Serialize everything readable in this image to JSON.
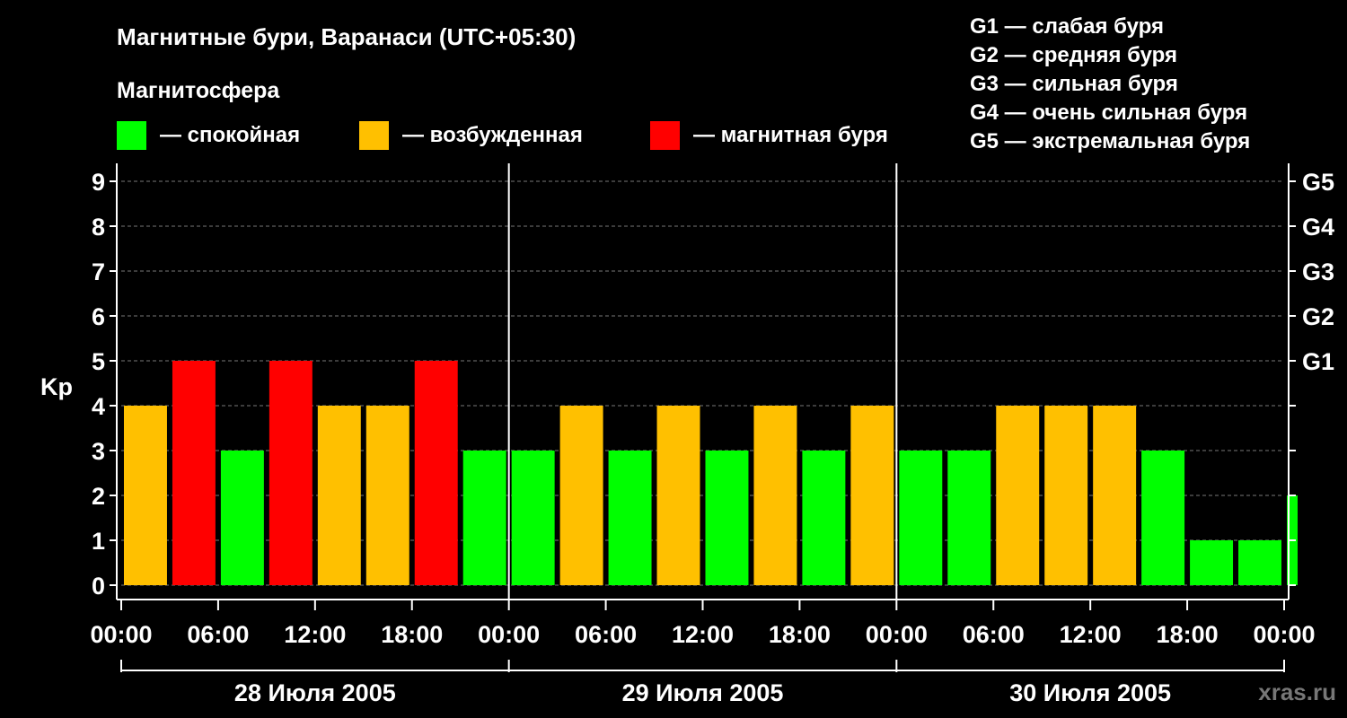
{
  "header": {
    "title": "Магнитные бури, Варанаси (UTC+05:30)",
    "magnetosphere_label": "Магнитосфера"
  },
  "legend": {
    "items": [
      {
        "label": "— спокойная",
        "color": "#00ff00"
      },
      {
        "label": "— возбужденная",
        "color": "#ffc000"
      },
      {
        "label": "— магнитная буря",
        "color": "#ff0000"
      }
    ]
  },
  "g_scale_legend": [
    "G1 — слабая буря",
    "G2 — средняя буря",
    "G3 — сильная буря",
    "G4 — очень сильная буря",
    "G5 — экстремальная буря"
  ],
  "watermark": "xras.ru",
  "chart_data": {
    "type": "bar",
    "ylabel": "Kp",
    "ylim": [
      0,
      9
    ],
    "yticks": [
      "0",
      "1",
      "2",
      "3",
      "4",
      "5",
      "6",
      "7",
      "8",
      "9"
    ],
    "right_ticks": [
      {
        "value": 5,
        "label": "G1"
      },
      {
        "value": 6,
        "label": "G2"
      },
      {
        "value": 7,
        "label": "G3"
      },
      {
        "value": 8,
        "label": "G4"
      },
      {
        "value": 9,
        "label": "G5"
      }
    ],
    "grid": true,
    "xtick_labels": [
      "00:00",
      "06:00",
      "12:00",
      "18:00",
      "00:00",
      "06:00",
      "12:00",
      "18:00",
      "00:00",
      "06:00",
      "12:00",
      "18:00",
      "00:00"
    ],
    "days": [
      "28 Июля 2005",
      "29 Июля 2005",
      "30 Июля 2005"
    ],
    "interval_hours": 3,
    "values": [
      4,
      5,
      3,
      5,
      4,
      4,
      5,
      3,
      3,
      4,
      3,
      4,
      3,
      4,
      3,
      4,
      3,
      3,
      4,
      4,
      4,
      3,
      1,
      1,
      2
    ],
    "colors": {
      "calm": "#00ff00",
      "excited": "#ffc000",
      "storm": "#ff0000"
    }
  }
}
